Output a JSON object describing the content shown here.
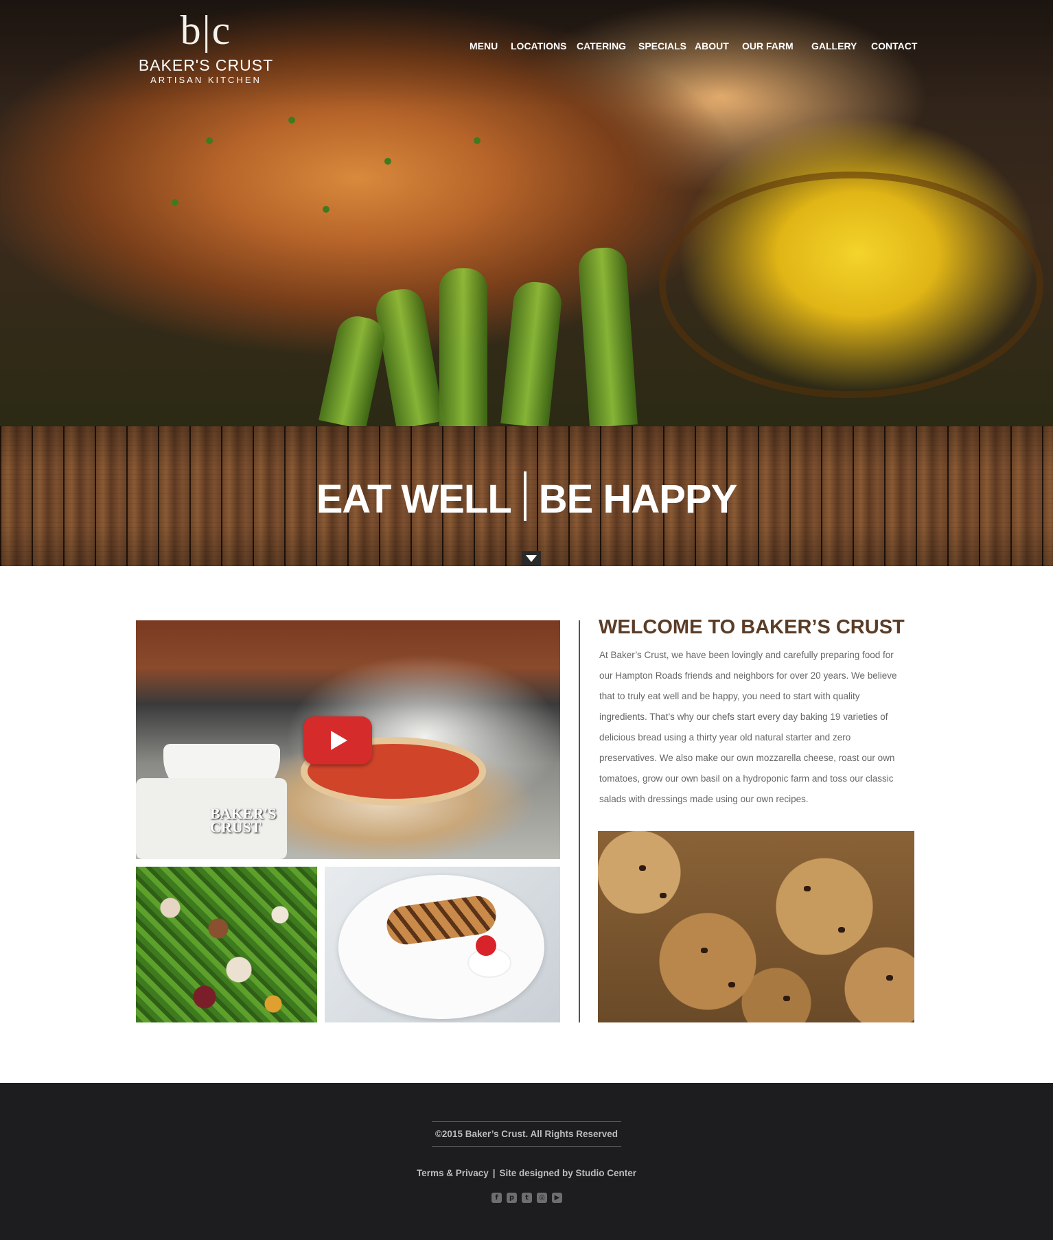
{
  "brand": {
    "logo_mark": "b|c",
    "name": "BAKER'S CRUST",
    "subtitle": "ARTISAN KITCHEN"
  },
  "nav": {
    "items": [
      "MENU",
      "LOCATIONS",
      "CATERING",
      "SPECIALS",
      "ABOUT",
      "OUR FARM",
      "GALLERY",
      "CONTACT"
    ]
  },
  "hero": {
    "image": "grilled salmon with asparagus and lemon"
  },
  "tagline": {
    "left": "EAT WELL",
    "right": "BE HAPPY"
  },
  "video": {
    "logo_text_line1": "BAKER'S",
    "logo_text_line2": "CRUST",
    "icon": "play-icon"
  },
  "welcome": {
    "title": "WELCOME TO BAKER’S CRUST",
    "body": "At Baker’s Crust, we have been lovingly and carefully preparing food for our Hampton Roads friends and neighbors for over 20 years. We believe that to truly eat well and be happy, you need to start with quality ingredients. That’s why our chefs start every day baking 19 varieties of delicious bread using a thirty year old natural starter and zero preservatives. We also make our own mozzarella cheese, roast our own tomatoes, grow our own basil on a hydroponic farm and toss our classic salads with dressings made using our own recipes."
  },
  "footer": {
    "copyright": "©2015 Baker’s Crust. All Rights Reserved",
    "terms": "Terms & Privacy",
    "separator": "|",
    "designed_by": "Site designed by Studio Center",
    "social": [
      {
        "name": "facebook-icon",
        "glyph": "f"
      },
      {
        "name": "pinterest-icon",
        "glyph": "p"
      },
      {
        "name": "twitter-icon",
        "glyph": "t"
      },
      {
        "name": "instagram-icon",
        "glyph": "◎"
      },
      {
        "name": "youtube-icon",
        "glyph": "▶"
      }
    ]
  },
  "colors": {
    "welcome_title": "#5a3d27",
    "footer_bg": "#1d1d1f",
    "youtube_red": "#d62b2b"
  }
}
